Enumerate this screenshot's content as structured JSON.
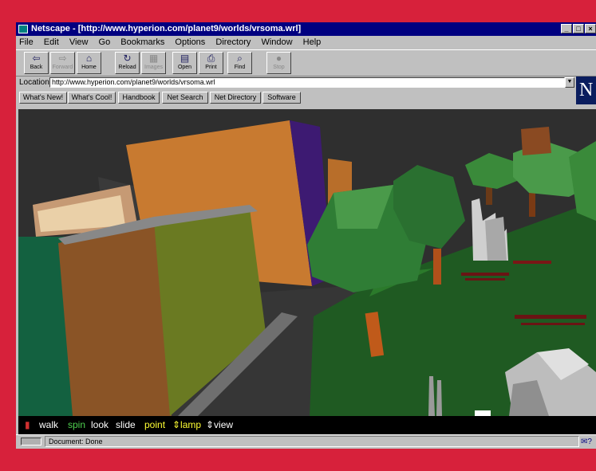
{
  "window": {
    "title": "Netscape - [http://www.hyperion.com/planet9/worlds/vrsoma.wrl]",
    "controls": [
      "_",
      "□",
      "×"
    ]
  },
  "menu": [
    "File",
    "Edit",
    "View",
    "Go",
    "Bookmarks",
    "Options",
    "Directory",
    "Window",
    "Help"
  ],
  "toolbar": [
    {
      "label": "Back",
      "icon": "back-arrow-icon",
      "glyph": "⇦",
      "enabled": true
    },
    {
      "label": "Forward",
      "icon": "forward-arrow-icon",
      "glyph": "⇨",
      "enabled": false
    },
    {
      "label": "Home",
      "icon": "home-icon",
      "glyph": "⌂",
      "enabled": true
    },
    {
      "label": "Reload",
      "icon": "reload-icon",
      "glyph": "↻",
      "enabled": true
    },
    {
      "label": "Images",
      "icon": "images-icon",
      "glyph": "▦",
      "enabled": false
    },
    {
      "label": "Open",
      "icon": "open-icon",
      "glyph": "▤",
      "enabled": true
    },
    {
      "label": "Print",
      "icon": "print-icon",
      "glyph": "⎙",
      "enabled": true
    },
    {
      "label": "Find",
      "icon": "find-icon",
      "glyph": "⌕",
      "enabled": true
    },
    {
      "label": "Stop",
      "icon": "stop-icon",
      "glyph": "●",
      "enabled": false
    }
  ],
  "location": {
    "label": "Location:",
    "url": "http://www.hyperion.com/planet9/worlds/vrsoma.wrl"
  },
  "logo": "N",
  "directory_buttons": [
    "What's New!",
    "What's Cool!",
    "Handbook",
    "Net Search",
    "Net Directory",
    "Software"
  ],
  "vrml_controls": [
    {
      "label": "walk",
      "color": "#ffffff"
    },
    {
      "label": "spin",
      "color": "#4fd04f"
    },
    {
      "label": "look",
      "color": "#ffffff"
    },
    {
      "label": "slide",
      "color": "#ffffff"
    },
    {
      "label": "point",
      "color": "#ffff33"
    },
    {
      "label": "⇕lamp",
      "color": "#ffff33"
    },
    {
      "label": "⇕view",
      "color": "#ffffff"
    }
  ],
  "status": {
    "text": "Document: Done",
    "mail_icon": "mail-icon",
    "mail_glyph": "✉?"
  },
  "colors": {
    "border": "#d7213b",
    "titlebar": "#000080",
    "ground": "#1f5a22",
    "road": "#3a3a3a"
  }
}
